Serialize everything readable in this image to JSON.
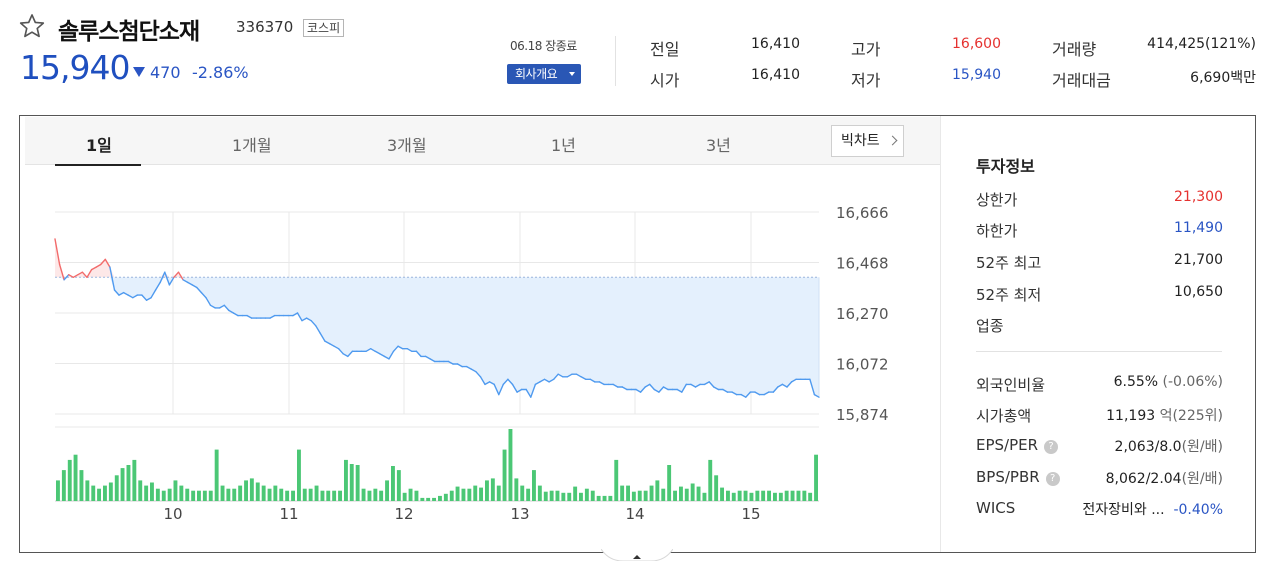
{
  "header": {
    "name": "솔루스첨단소재",
    "code": "336370",
    "market": "코스피",
    "price": "15,940",
    "change": "470",
    "change_rate": "-2.86%",
    "close_label": "06.18 장종료",
    "company_button": "회사개요"
  },
  "summary": {
    "prev_close_label": "전일",
    "prev_close": "16,410",
    "open_label": "시가",
    "open": "16,410",
    "high_label": "고가",
    "high": "16,600",
    "low_label": "저가",
    "low": "15,940",
    "volume_label": "거래량",
    "volume": "414,425(121%)",
    "amount_label": "거래대금",
    "amount": "6,690백만"
  },
  "tabs": [
    "1일",
    "1개월",
    "3개월",
    "1년",
    "3년"
  ],
  "candle_button": "빅차트",
  "chart_data": {
    "type": "line",
    "price_axis": {
      "ticks": [
        "16,666",
        "16,468",
        "16,270",
        "16,072",
        "15,874"
      ],
      "ylim": [
        15874,
        16666
      ]
    },
    "x_ticks": [
      "10",
      "11",
      "12",
      "13",
      "14",
      "15"
    ],
    "reference_value": 16410,
    "price_series": [
      16560,
      16460,
      16400,
      16420,
      16410,
      16420,
      16430,
      16410,
      16440,
      16450,
      16460,
      16480,
      16450,
      16360,
      16340,
      16350,
      16340,
      16330,
      16340,
      16340,
      16320,
      16330,
      16360,
      16390,
      16430,
      16380,
      16410,
      16430,
      16400,
      16390,
      16380,
      16370,
      16350,
      16330,
      16300,
      16290,
      16290,
      16300,
      16280,
      16270,
      16260,
      16260,
      16260,
      16250,
      16250,
      16250,
      16250,
      16250,
      16260,
      16260,
      16260,
      16260,
      16260,
      16270,
      16240,
      16250,
      16240,
      16220,
      16190,
      16160,
      16150,
      16140,
      16130,
      16110,
      16100,
      16120,
      16120,
      16120,
      16120,
      16130,
      16120,
      16110,
      16100,
      16090,
      16120,
      16140,
      16130,
      16130,
      16120,
      16120,
      16100,
      16100,
      16090,
      16080,
      16080,
      16080,
      16080,
      16070,
      16070,
      16060,
      16060,
      16050,
      16040,
      16020,
      15990,
      16000,
      15990,
      15950,
      15990,
      16010,
      15990,
      15960,
      15970,
      15970,
      15940,
      15990,
      16000,
      16010,
      16000,
      16010,
      16030,
      16020,
      16020,
      16030,
      16030,
      16020,
      16010,
      16010,
      16000,
      16000,
      15990,
      15990,
      15990,
      15980,
      15980,
      15970,
      15970,
      15970,
      15960,
      15980,
      15990,
      15970,
      15960,
      15980,
      15970,
      15970,
      15970,
      15960,
      15990,
      15990,
      15980,
      15990,
      15990,
      16000,
      15980,
      15970,
      15970,
      15960,
      15960,
      15950,
      15950,
      15940,
      15960,
      15960,
      15950,
      15950,
      15960,
      15960,
      15980,
      15990,
      15980,
      16000,
      16010,
      16010,
      16010,
      16010,
      15950,
      15940
    ],
    "volume_series": [
      20,
      30,
      40,
      45,
      30,
      20,
      15,
      12,
      15,
      18,
      25,
      32,
      35,
      40,
      20,
      15,
      18,
      12,
      10,
      12,
      20,
      15,
      12,
      10,
      10,
      10,
      10,
      50,
      15,
      12,
      12,
      15,
      20,
      22,
      18,
      15,
      12,
      15,
      12,
      10,
      10,
      50,
      12,
      12,
      15,
      10,
      10,
      10,
      10,
      40,
      36,
      35,
      12,
      10,
      12,
      10,
      20,
      34,
      30,
      8,
      12,
      10,
      3,
      3,
      3,
      5,
      7,
      10,
      14,
      12,
      12,
      15,
      13,
      20,
      22,
      15,
      50,
      70,
      22,
      15,
      12,
      30,
      15,
      9,
      10,
      10,
      8,
      8,
      14,
      8,
      12,
      10,
      5,
      5,
      5,
      40,
      15,
      15,
      9,
      10,
      10,
      15,
      20,
      12,
      35,
      10,
      14,
      12,
      17,
      14,
      8,
      40,
      25,
      13,
      10,
      8,
      10,
      10,
      8,
      10,
      10,
      10,
      8,
      8,
      10,
      10,
      10,
      10,
      8,
      45
    ]
  },
  "investment": {
    "title": "투자정보",
    "upper_limit_label": "상한가",
    "upper_limit": "21,300",
    "lower_limit_label": "하한가",
    "lower_limit": "11,490",
    "high52_label": "52주 최고",
    "high52": "21,700",
    "low52_label": "52주 최저",
    "low52": "10,650",
    "sector_label": "업종",
    "foreign_label": "외국인비율",
    "foreign_value": "6.55%",
    "foreign_change": "(-0.06%)",
    "mktcap_label": "시가총액",
    "mktcap_value": "11,193",
    "mktcap_unit": "억(225위)",
    "eps_label": "EPS/PER",
    "eps_value": "2,063/8.0",
    "eps_unit": "(원/배)",
    "bps_label": "BPS/PBR",
    "bps_value": "8,062/2.04",
    "bps_unit": "(원/배)",
    "wics_label": "WICS",
    "wics_value": "전자장비와 ...",
    "wics_change": "-0.40%"
  },
  "colors": {
    "up": "#e5312f",
    "down": "#2a55c4",
    "volume": "#4bc775",
    "area": "#e4f0fd",
    "line": "#4f9aef"
  }
}
